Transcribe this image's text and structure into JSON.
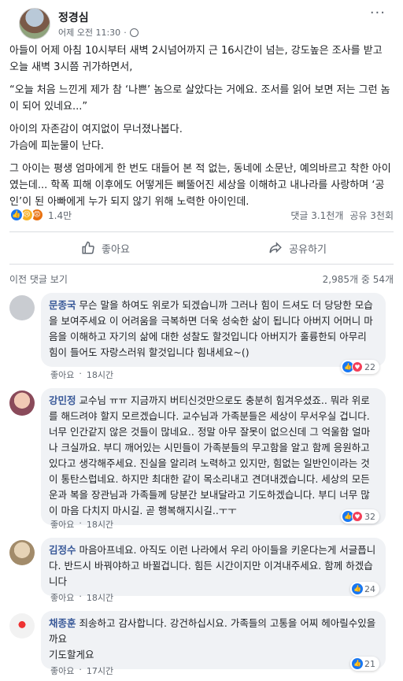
{
  "post": {
    "author": "정경심",
    "time": "어제 오전 11:30",
    "more": "···",
    "paragraphs": [
      "아들이 어제 아침 10시부터 새벽 2시넘어까지 근 16시간이 넘는, 강도높은 조사를 받고 오늘 새벽 3시쯤 귀가하면서,",
      "“오늘 처음 느낀게 제가 참 ‘나쁜’ 놈으로 살았다는 거에요. 조서를 읽어 보면 저는 그런 놈이 되어 있네요...”",
      "아이의 자존감이 여지없이 무너졌나봅다.",
      "가슴에 피눈물이 난다.",
      "그 아이는 평생 엄마에게 한 번도 대들어 본 적 없는, 동네에 소문난, 예의바르고 착한 아이였는데... 학폭 피해 이후에도 어떻게든 삐뚤어진 세상을 이해하고 내나라를 사랑하며 ‘공인’이 된 아빠에게 누가 되지 않기 위해 노력한 아이인데."
    ],
    "reaction_count": "1.4만",
    "comments_count": "댓글 3.1천개",
    "shares_count": "공유 3천회",
    "like_label": "좋아요",
    "share_label": "공유하기"
  },
  "comments_header": {
    "prev_label": "이전 댓글 보기",
    "count_label": "2,985개 중 54개"
  },
  "comments": [
    {
      "name": "문종국",
      "text": "무슨 말을 하여도 위로가 되겠습니까 그러나 힘이 드셔도 더 당당한 모습을 보여주세요 이 어려움을 극복하면 더욱 성숙한 삶이 됩니다 아버지 어머니 마음을 이해하고 자기의 삶에 대한 성찰도 할것입니다 아버지가 훌륭한되 아무리 힘이 들어도 자랑스러워 할것입니다 힘내세요~()",
      "like": "좋아요",
      "time": "18시간",
      "reactions": "22",
      "avatar_color": "#c9ccd1"
    },
    {
      "name": "강민정",
      "text": "교수님 ㅠㅠ 지금까지 버티신것만으로도 충분히 힘겨우셨죠.. 뭐라 위로를 해드려야 할지 모르겠습니다. 교수님과 가족분들은 세상이 무서우실 겁니다. 너무 인간같지 않은 것들이 많네요.. 정말 아무 잘못이 없으신데 그 억울함 얼마나 크실까요. 부디 깨어있는 시민들이 가족분들의 무고함을 알고 함께 응원하고 있다고 생각해주세요. 진실을 알리려 노력하고 있지만, 힘없는 일반인이라는 것이 통탄스럽네요. 하지만 최대한 같이 목소리내고 견뎌내겠습니다. 세상의 모든 운과 복을 장관님과 가족들께 당분간 보내달라고 기도하겠습니다. 부디 너무 많이 마음 다치지 마시길. 곧 행복해지시길..ㅜㅜ",
      "like": "좋아요",
      "time": "18시간",
      "reactions": "32",
      "avatar_color": "#8a4a5a"
    },
    {
      "name": "김정수",
      "text": "마음아프네요. 아직도 이런 나라에서 우리 아이들을 키운다는게 서글픕니다. 반드시 바꿔야하고 바뀔겁니다. 힘든 시간이지만 이겨내주세요. 함께 하겠습니다",
      "like": "좋아요",
      "time": "18시간",
      "reactions": "24",
      "avatar_color": "#a28b6a"
    },
    {
      "name": "채종훈",
      "text": "죄송하고 감사합니다. 강건하십시요. 가족들의 고통을 어찌 헤아릴수있을까요\n기도할게요",
      "like": "좋아요",
      "time": "17시간",
      "reactions": "21",
      "avatar_color": "#d9d9d9"
    }
  ]
}
